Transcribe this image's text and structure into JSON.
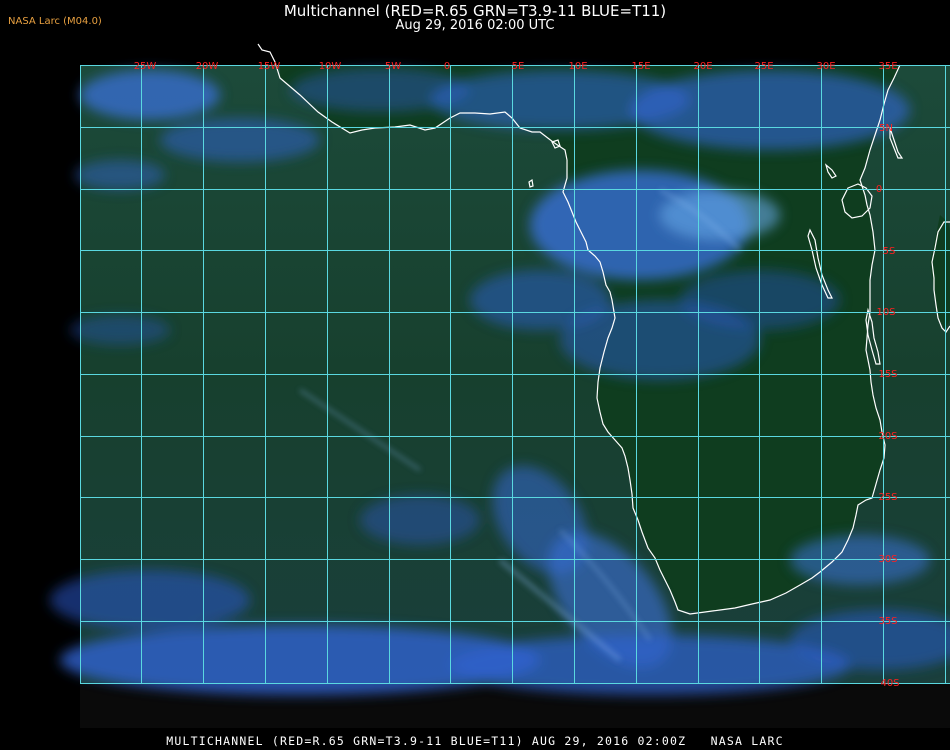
{
  "header": {
    "title": "Multichannel (RED=R.65 GRN=T3.9-11 BLUE=T11)",
    "subtitle": "Aug 29, 2016 02:00 UTC",
    "brand": "NASA Larc (M04.0)"
  },
  "footer": {
    "text": "MULTICHANNEL (RED=R.65 GRN=T3.9-11 BLUE=T11) AUG 29, 2016 02:00Z   NASA LARC"
  },
  "colors": {
    "background": "#000000",
    "grid": "#5ad8e0",
    "labels": "#ff2020",
    "coast": "#ffffff",
    "land": "#0d3a1a",
    "ocean": "#143d2e",
    "cloud": "#2f62d8",
    "brand": "#e8a040"
  },
  "map": {
    "projection": "lat/lon",
    "lon_labels": [
      "25W",
      "20W",
      "15W",
      "10W",
      "5W",
      "0",
      "5E",
      "10E",
      "15E",
      "20E",
      "25E",
      "30E",
      "35E"
    ],
    "lat_labels": [
      "5N",
      "0",
      "5S",
      "10S",
      "15S",
      "20S",
      "25S",
      "30S",
      "35S",
      "40S"
    ]
  }
}
